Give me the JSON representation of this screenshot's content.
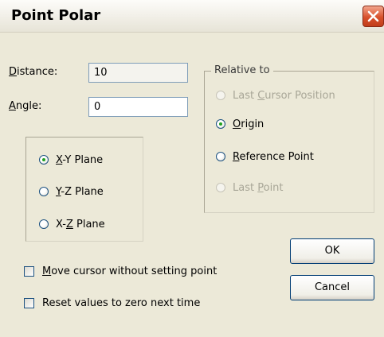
{
  "window": {
    "title": "Point Polar"
  },
  "distance": {
    "label": "istance:",
    "label_key": "D",
    "value": "10"
  },
  "angle": {
    "label": "ngle:",
    "label_key": "A",
    "value": "0"
  },
  "plane_group": {
    "options": [
      {
        "pre": "",
        "key": "X",
        "post": "-Y Plane",
        "checked": true
      },
      {
        "pre": "",
        "key": "Y",
        "post": "-Z Plane",
        "checked": false
      },
      {
        "pre": "X-",
        "key": "Z",
        "post": " Plane",
        "checked": false
      }
    ]
  },
  "relative_group": {
    "legend": "Relative to",
    "options": [
      {
        "pre": "Last ",
        "key": "C",
        "post": "ursor Position",
        "checked": false,
        "disabled": true
      },
      {
        "pre": "",
        "key": "O",
        "post": "rigin",
        "checked": true,
        "disabled": false
      },
      {
        "pre": "",
        "key": "R",
        "post": "eference Point",
        "checked": false,
        "disabled": false
      },
      {
        "pre": "Last ",
        "key": "P",
        "post": "oint",
        "checked": false,
        "disabled": true
      }
    ]
  },
  "checkboxes": [
    {
      "key": "M",
      "post": "ove cursor without setting point",
      "checked": false
    },
    {
      "key": "",
      "post": "Reset values to zero next time",
      "checked": false
    }
  ],
  "buttons": {
    "ok": "OK",
    "cancel": "Cancel"
  },
  "colors": {
    "window_bg": "#ece9d8",
    "close_button": "#d8512c",
    "radio_dot": "#21a121"
  }
}
